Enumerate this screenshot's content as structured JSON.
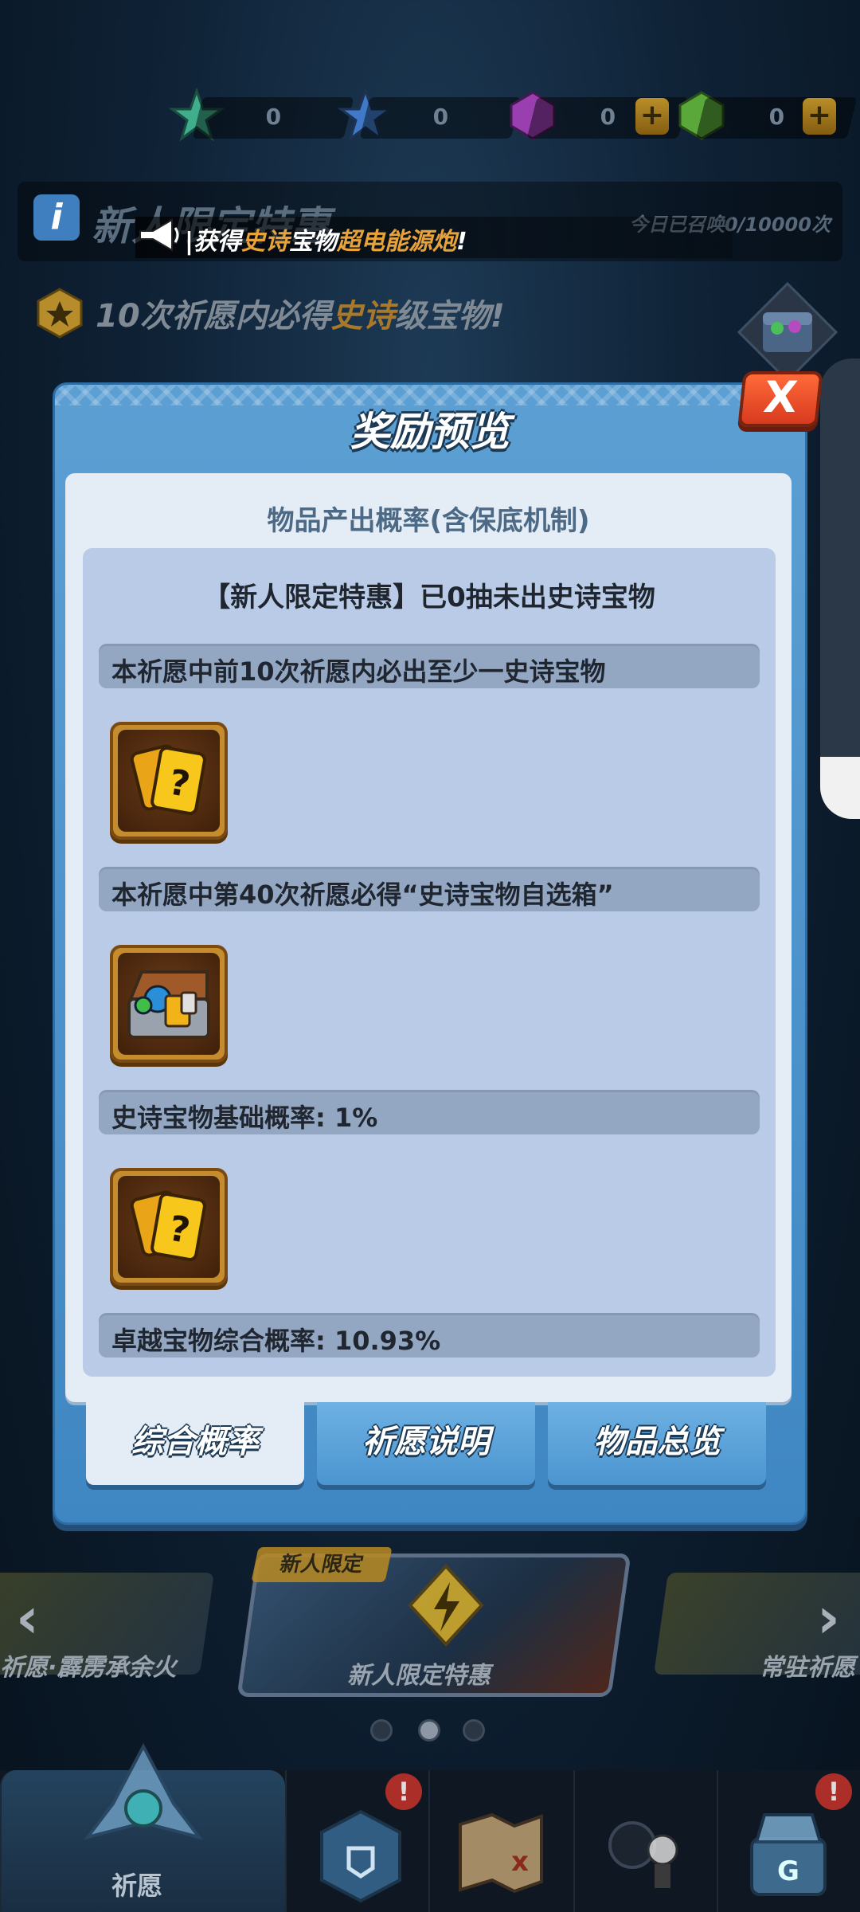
{
  "currencies": [
    {
      "name": "star-token-green",
      "value": "0",
      "color": "#3fae8c"
    },
    {
      "name": "star-token-blue",
      "value": "0",
      "color": "#3f79c8"
    },
    {
      "name": "purple-gem",
      "value": "0",
      "color": "#9a3fb0"
    },
    {
      "name": "green-gem",
      "value": "0",
      "color": "#5aa83a"
    }
  ],
  "promo": {
    "title": "新人限定特惠",
    "count": "今日已召唤0/10000次"
  },
  "broadcast": {
    "prefix": "|获得",
    "rarity": "史诗",
    "middle": "宝物",
    "item": "超电能源炮",
    "suffix": "!"
  },
  "pity": {
    "prefix": "10次祈愿内必得",
    "rarity": "史诗",
    "suffix": "级宝物!"
  },
  "modal": {
    "title": "奖励预览",
    "close_label": "X",
    "content_heading": "物品产出概率(含保底机制)",
    "inner_heading": "【新人限定特惠】已0抽未出史诗宝物",
    "rules": [
      {
        "text": "本祈愿中前10次祈愿内必出至少一史诗宝物",
        "icon": "mystery-card-icon"
      },
      {
        "text": "本祈愿中第40次祈愿必得“史诗宝物自选箱”",
        "icon": "treasure-chest-icon"
      },
      {
        "text": "史诗宝物基础概率: 1%",
        "icon": "mystery-card-icon"
      },
      {
        "text": "卓越宝物综合概率: 10.93%",
        "icon": null
      }
    ],
    "tabs": [
      {
        "label": "综合概率",
        "active": true
      },
      {
        "label": "祈愿说明",
        "active": false
      },
      {
        "label": "物品总览",
        "active": false
      }
    ]
  },
  "carousel": {
    "left_label": "祈愿·霹雳承余火",
    "center_tag": "新人限定",
    "center_label": "新人限定特惠",
    "right_label": "常驻祈愿",
    "active_index": 1,
    "dot_count": 3
  },
  "bottom_nav": {
    "items": [
      {
        "label": "祈愿",
        "icon": "wish-icon",
        "active": true,
        "badge": null
      },
      {
        "label": "",
        "icon": "shield-card-icon",
        "active": false,
        "badge": "!"
      },
      {
        "label": "",
        "icon": "map-scroll-icon",
        "active": false,
        "badge": null
      },
      {
        "label": "",
        "icon": "characters-icon",
        "active": false,
        "badge": null
      },
      {
        "label": "",
        "icon": "gacha-machine-icon",
        "active": false,
        "badge": "!"
      }
    ]
  }
}
